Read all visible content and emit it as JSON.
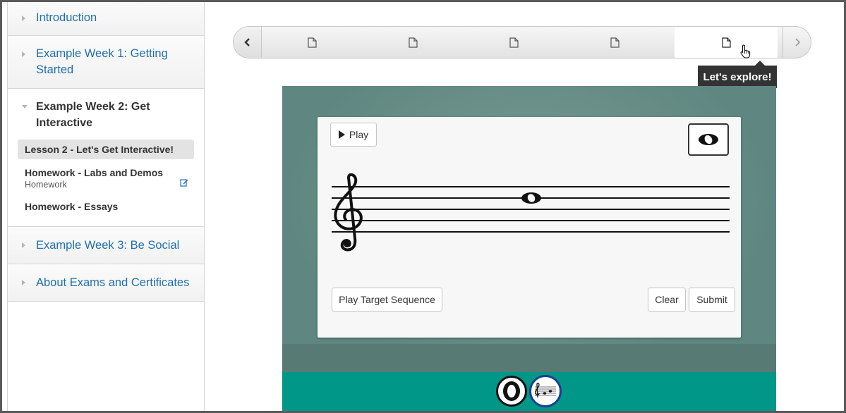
{
  "sidebar": {
    "chapters": [
      {
        "title": "Introduction"
      },
      {
        "title": "Example Week 1: Getting Started"
      },
      {
        "title": "Example Week 2: Get Interactive"
      },
      {
        "title": "Example Week 3: Be Social"
      },
      {
        "title": "About Exams and Certificates"
      }
    ],
    "sections": [
      {
        "title": "Lesson 2 - Let's Get Interactive!"
      },
      {
        "title": "Homework - Labs and Demos",
        "subtitle": "Homework"
      },
      {
        "title": "Homework - Essays"
      }
    ]
  },
  "seqnav": {
    "prev_icon": "chevron-left-icon",
    "next_icon": "chevron-right-icon",
    "tabs": [
      "document-icon",
      "document-icon",
      "document-icon",
      "document-icon",
      "document-icon"
    ],
    "active_tab": 5
  },
  "tooltip": {
    "text": "Let's explore!"
  },
  "activity": {
    "play_label": "Play",
    "play_target_label": "Play Target Sequence",
    "clear_label": "Clear",
    "submit_label": "Submit",
    "clef": "treble",
    "note_type": "whole",
    "tools": [
      "whole-note-tool-icon",
      "staff-tool-icon"
    ]
  },
  "colors": {
    "link": "#1f6fb0",
    "footer": "#009688",
    "board": "#6b8f88",
    "tooltip": "#333333"
  }
}
